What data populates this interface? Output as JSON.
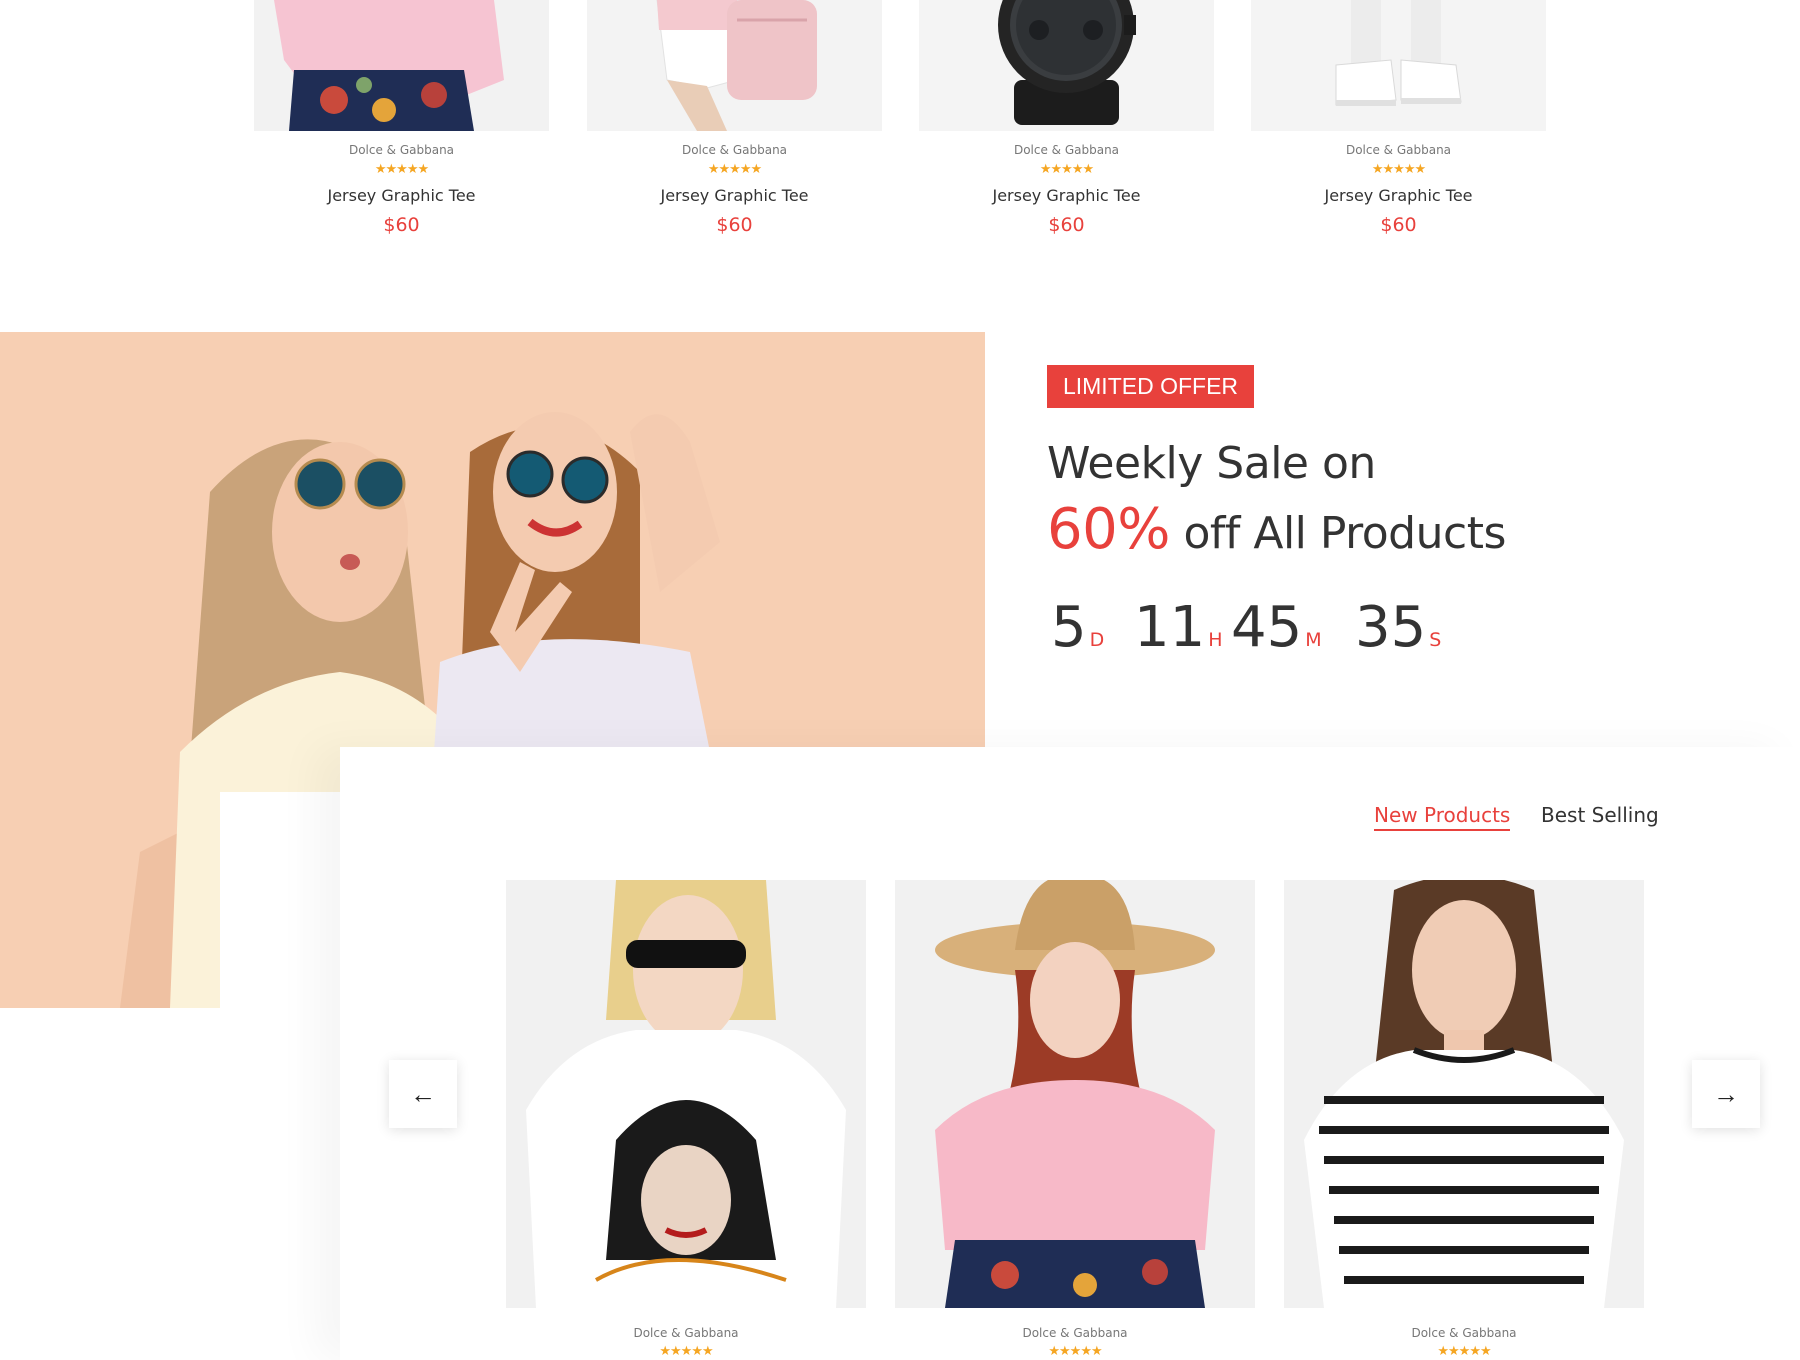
{
  "top_products": [
    {
      "brand": "Dolce & Gabbana",
      "rating": 5,
      "stars": "★★★★★",
      "name": "Jersey Graphic Tee",
      "price": "$60",
      "image_icon": "pink-sweater-floral-skirt-image"
    },
    {
      "brand": "Dolce & Gabbana",
      "rating": 5,
      "stars": "★★★★★",
      "name": "Jersey Graphic Tee",
      "price": "$60",
      "image_icon": "pink-backpack-image"
    },
    {
      "brand": "Dolce & Gabbana",
      "rating": 5,
      "stars": "★★★★★",
      "name": "Jersey Graphic Tee",
      "price": "$60",
      "image_icon": "black-watch-image"
    },
    {
      "brand": "Dolce & Gabbana",
      "rating": 5,
      "stars": "★★★★★",
      "name": "Jersey Graphic Tee",
      "price": "$60",
      "image_icon": "white-sneakers-image"
    }
  ],
  "promo": {
    "badge": "LIMITED OFFER",
    "headline_line1": "Weekly Sale on",
    "headline_percent": "60%",
    "headline_rest": " off All Products",
    "countdown": [
      {
        "value": "5",
        "unit": "D"
      },
      {
        "value": "11",
        "unit": "H"
      },
      {
        "value": "45",
        "unit": "M"
      },
      {
        "value": "35",
        "unit": "S"
      }
    ],
    "image_icon": "two-women-sunglasses-image"
  },
  "tabs": [
    {
      "label": "New Products",
      "active": true
    },
    {
      "label": "Best Selling",
      "active": false
    }
  ],
  "carousel": {
    "prev_icon": "arrow-left-icon",
    "next_icon": "arrow-right-icon",
    "prev_glyph": "←",
    "next_glyph": "→"
  },
  "products": [
    {
      "brand": "Dolce & Gabbana",
      "rating": 5,
      "stars": "★★★★★",
      "image_icon": "graphic-tee-model-image"
    },
    {
      "brand": "Dolce & Gabbana",
      "rating": 5,
      "stars": "★★★★★",
      "image_icon": "straw-hat-pink-sweater-model-image"
    },
    {
      "brand": "Dolce & Gabbana",
      "rating": 5,
      "stars": "★★★★★",
      "image_icon": "striped-tee-model-image"
    }
  ],
  "colors": {
    "accent": "#e8413c",
    "star": "#f5a623",
    "text": "#333333",
    "promo_bg": "#f7cdb0"
  }
}
